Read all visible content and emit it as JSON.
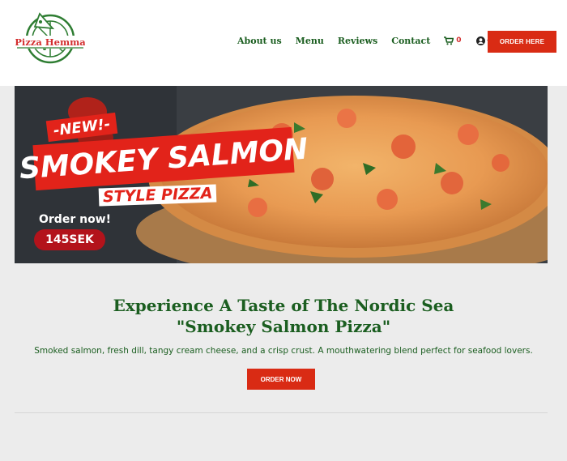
{
  "header": {
    "logo_text": "Pizza Hemma",
    "nav": [
      {
        "label": "About us"
      },
      {
        "label": "Menu"
      },
      {
        "label": "Reviews"
      },
      {
        "label": "Contact"
      }
    ],
    "cart_count": "0",
    "cart_icon": "cart-icon",
    "user_icon": "user-circle-icon",
    "order_button": "ORDER HERE"
  },
  "hero": {
    "badge": "-NEW!-",
    "title": "SMOKEY SALMON",
    "subtitle": "STYLE PIZZA",
    "order_now": "Order now!",
    "price": "145SEK"
  },
  "main": {
    "headline_line1": "Experience A Taste of The Nordic Sea",
    "headline_line2": "\"Smokey Salmon Pizza\"",
    "description": "Smoked salmon, fresh dill, tangy cream cheese, and a crisp crust. A mouthwatering blend perfect for seafood lovers.",
    "cta": "ORDER NOW"
  },
  "colors": {
    "brand_green": "#1b5e20",
    "brand_red": "#d92b14",
    "background": "#ececec"
  }
}
